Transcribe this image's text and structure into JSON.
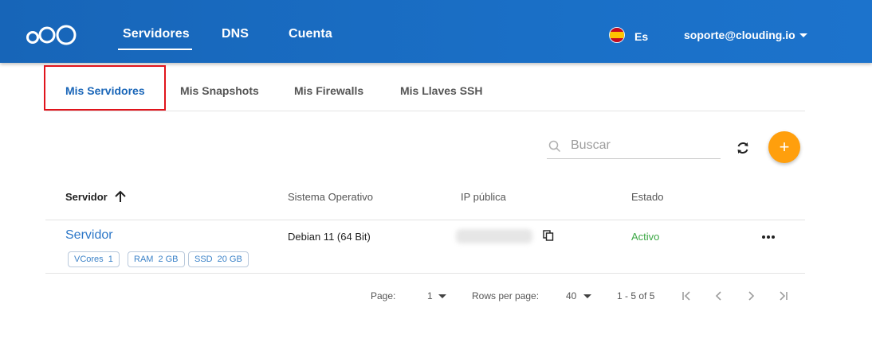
{
  "header": {
    "nav": [
      {
        "label": "Servidores",
        "active": true
      },
      {
        "label": "DNS",
        "active": false
      },
      {
        "label": "Cuenta",
        "active": false
      }
    ],
    "language": "Es",
    "account": "soporte@clouding.io"
  },
  "tabs": [
    {
      "label": "Mis Servidores",
      "active": true
    },
    {
      "label": "Mis Snapshots",
      "active": false
    },
    {
      "label": "Mis Firewalls",
      "active": false
    },
    {
      "label": "Mis Llaves SSH",
      "active": false
    }
  ],
  "search": {
    "placeholder": "Buscar",
    "value": ""
  },
  "table": {
    "columns": [
      "Servidor",
      "Sistema Operativo",
      "IP pública",
      "Estado"
    ],
    "rows": [
      {
        "name": "Servidor",
        "chips": [
          {
            "label": "VCores",
            "value": "1"
          },
          {
            "label": "RAM",
            "value": "2 GB"
          },
          {
            "label": "SSD",
            "value": "20 GB"
          }
        ],
        "os": "Debian 11 (64 Bit)",
        "status": "Activo"
      }
    ]
  },
  "pagination": {
    "page_label": "Page:",
    "page_value": "1",
    "rows_label": "Rows per page:",
    "rows_value": "40",
    "range": "1 - 5 of 5"
  },
  "colors": {
    "header_blue": "#1a6fc6",
    "accent_orange": "#ff9f0d",
    "link_blue": "#2c77c8",
    "status_green": "#3ca845",
    "highlight_red": "#e0141c"
  },
  "icons": [
    "logo-icon",
    "spain-flag-icon",
    "chevron-down-icon",
    "search-icon",
    "refresh-icon",
    "plus-icon",
    "arrow-up-icon",
    "copy-icon",
    "more-horizontal-icon",
    "first-page-icon",
    "prev-page-icon",
    "next-page-icon",
    "last-page-icon"
  ]
}
